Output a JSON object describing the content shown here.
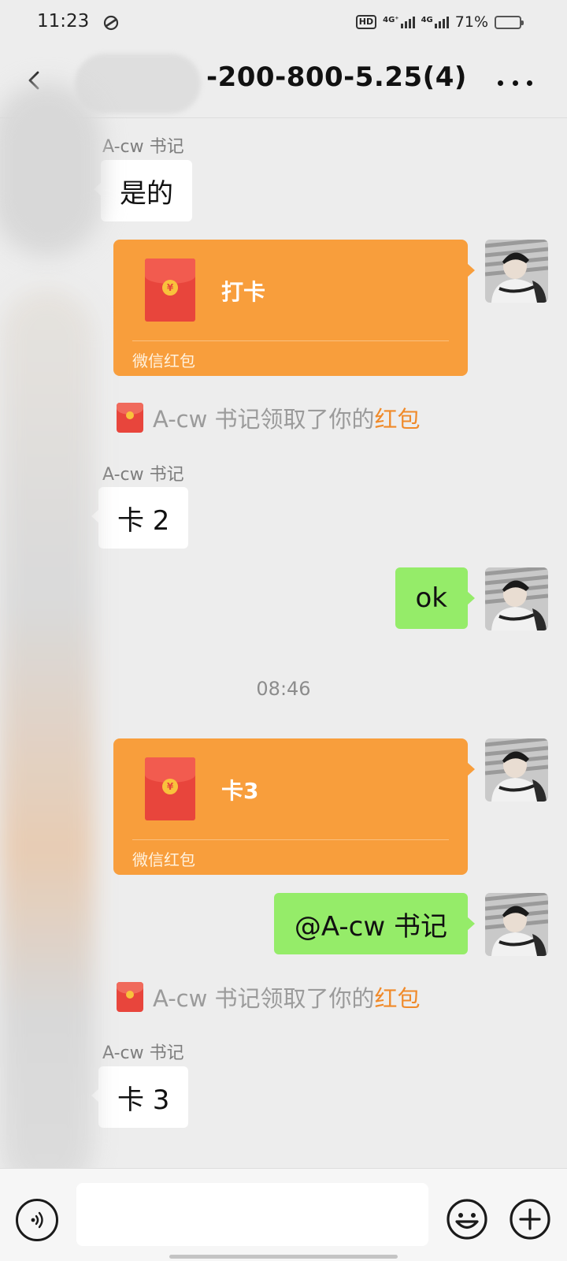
{
  "status_bar": {
    "time": "11:23",
    "network_1": "4G⁺",
    "network_2": "4G",
    "hd": "HD",
    "battery_percent": "71%",
    "battery_level": 0.71
  },
  "header": {
    "title": "-200-800-5.25(4)"
  },
  "messages": [
    {
      "sender": "A-cw 书记",
      "text": "是的"
    },
    {
      "redpacket_title": "打卡",
      "redpacket_label": "微信红包"
    },
    {
      "notice_prefix": "A-cw 书记领取了你的",
      "notice_link": "红包"
    },
    {
      "sender": "A-cw 书记",
      "text": "卡 2"
    },
    {
      "text": "ok"
    },
    {
      "timestamp": "08:46"
    },
    {
      "redpacket_title": "卡3",
      "redpacket_label": "微信红包"
    },
    {
      "text": "@A-cw 书记"
    },
    {
      "notice_prefix": "A-cw 书记领取了你的",
      "notice_link": "红包"
    },
    {
      "sender": "A-cw 书记",
      "text": "卡 3"
    }
  ],
  "input_bar": {
    "placeholder": ""
  },
  "colors": {
    "background": "#ededed",
    "outgoing_bubble": "#95ec69",
    "redpacket": "#f89e3c",
    "link": "#f08a2a"
  },
  "icons": [
    "back-icon",
    "more-icon",
    "voice-icon",
    "emoji-icon",
    "plus-icon",
    "red-packet-icon"
  ]
}
